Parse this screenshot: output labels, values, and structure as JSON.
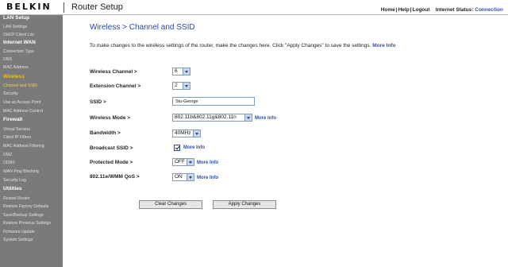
{
  "header": {
    "logo": "BELKIN",
    "app_title": "Router Setup",
    "home": "Home",
    "help": "Help",
    "logout": "Logout",
    "sep": "|",
    "status_label": "Internet Status:",
    "status_value": "Connection"
  },
  "sidebar": {
    "lan_head": "LAN Setup",
    "lan_settings": "LAN Settings",
    "dhcp_list": "DHCP Client List",
    "wan_head": "Internet WAN",
    "connection_type": "Connection Type",
    "dns": "DNS",
    "mac_address": "MAC Address",
    "wireless_head": "Wireless",
    "channel_ssid": "Channel and SSID",
    "security": "Security",
    "access_point": "Use as Access Point",
    "mac_control": "MAC Address Control",
    "firewall_head": "Firewall",
    "virtual_servers": "Virtual Servers",
    "client_ip_filters": "Client IP Filters",
    "mac_filtering": "MAC Address Filtering",
    "dmz": "DMZ",
    "ddns": "DDNS",
    "wan_ping": "WAN Ping Blocking",
    "security_log": "Security Log",
    "utilities_head": "Utilities",
    "restart_router": "Restart Router",
    "restore_defaults": "Restore Factory Defaults",
    "save_backup": "Save/Backup Settings",
    "restore_previous": "Restore Previous Settings",
    "firmware_update": "Firmware Update",
    "system_settings": "System Settings"
  },
  "main": {
    "title": "Wireless > Channel and SSID",
    "intro": "To make changes to the wireless settings of the router, make the changes here. Click \"Apply Changes\" to save the settings.",
    "more_info": "More Info",
    "wireless_channel_label": "Wireless Channel >",
    "wireless_channel_value": "6",
    "extension_channel_label": "Extension Channel >",
    "extension_channel_value": "2",
    "ssid_label": "SSID >",
    "ssid_value": "Stu-George",
    "wireless_mode_label": "Wireless Mode >",
    "wireless_mode_value": "802.11b&802.11g&802.11n",
    "bandwidth_label": "Bandwidth >",
    "bandwidth_value": "40MHz",
    "broadcast_ssid_label": "Broadcast SSID >",
    "protected_mode_label": "Protected Mode >",
    "protected_mode_value": "OFF",
    "wmm_label": "802.11e/WMM QoS >",
    "wmm_value": "ON",
    "clear_button": "Clear Changes",
    "apply_button": "Apply Changes"
  }
}
